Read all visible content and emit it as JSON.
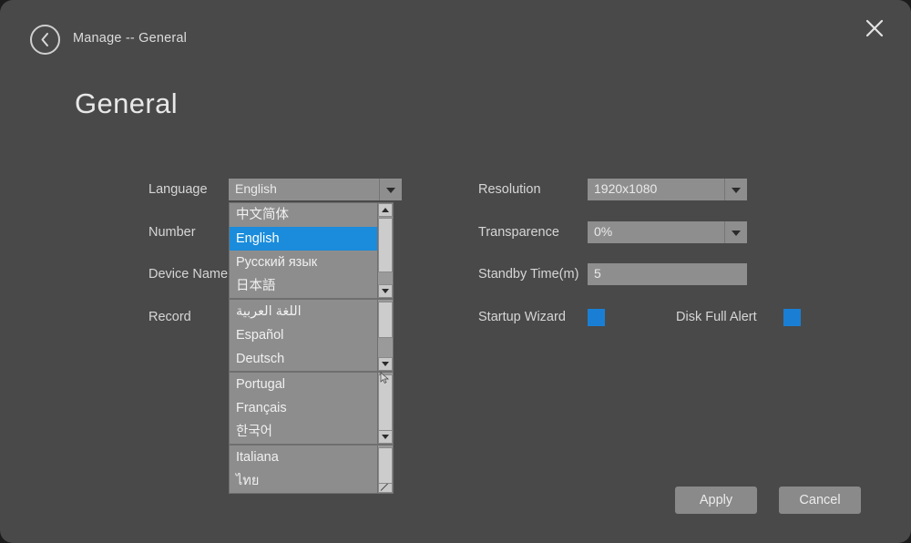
{
  "header": {
    "back_icon": "back-chevron-circle-icon",
    "breadcrumb": "Manage -- General",
    "close_icon": "close-x-icon"
  },
  "page_title": "General",
  "left_column": {
    "rows": [
      {
        "label": "Language"
      },
      {
        "label": "Number"
      },
      {
        "label": "Device Name"
      },
      {
        "label": "Record"
      }
    ],
    "language_select": {
      "value": "English",
      "arrow_icon": "chevron-down-icon",
      "expanded": true
    }
  },
  "language_dropdown": {
    "panels": [
      {
        "items": [
          {
            "label": "中文简体",
            "selected": false
          },
          {
            "label": "English",
            "selected": true
          },
          {
            "label": "Русский язык",
            "selected": false
          },
          {
            "label": "日本語",
            "selected": false
          }
        ]
      },
      {
        "items": [
          {
            "label": "اللغة العربية",
            "selected": false
          },
          {
            "label": "Español",
            "selected": false
          },
          {
            "label": "Deutsch",
            "selected": false
          }
        ]
      },
      {
        "items": [
          {
            "label": "Portugal",
            "selected": false
          },
          {
            "label": "Français",
            "selected": false
          },
          {
            "label": "한국어",
            "selected": false
          }
        ]
      },
      {
        "items": [
          {
            "label": "Italiana",
            "selected": false
          },
          {
            "label": "ไทย",
            "selected": false
          }
        ]
      }
    ],
    "scroll_up_icon": "scroll-up-arrow-icon",
    "scroll_down_icon": "scroll-down-arrow-icon",
    "resize_icon": "resize-grip-icon"
  },
  "right_column": {
    "resolution": {
      "label": "Resolution",
      "value": "1920x1080",
      "arrow_icon": "chevron-down-icon"
    },
    "transparence": {
      "label": "Transparence",
      "value": "0%",
      "arrow_icon": "chevron-down-icon"
    },
    "standby_time": {
      "label": "Standby Time(m)",
      "value": "5"
    },
    "startup_wizard": {
      "label": "Startup Wizard",
      "checked": true
    },
    "disk_full_alert": {
      "label": "Disk Full Alert",
      "checked": true
    }
  },
  "footer": {
    "apply_label": "Apply",
    "cancel_label": "Cancel"
  },
  "colors": {
    "window_bg": "#494949",
    "field_bg": "#8e8e8e",
    "accent_blue": "#1a8cdb",
    "checkbox_blue": "#1a7fd4",
    "button_bg": "#8a8a8a",
    "text": "#e8e8e8"
  }
}
